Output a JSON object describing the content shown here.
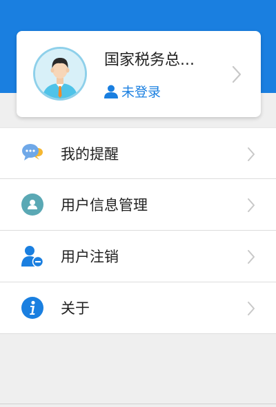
{
  "profile": {
    "name": "国家税务总...",
    "status": "未登录",
    "avatar_icon": "male-user-avatar",
    "status_icon": "user-icon"
  },
  "menu": {
    "items": [
      {
        "label": "我的提醒",
        "icon": "chat-bubble-icon"
      },
      {
        "label": "用户信息管理",
        "icon": "user-info-icon"
      },
      {
        "label": "用户注销",
        "icon": "user-remove-icon"
      },
      {
        "label": "关于",
        "icon": "info-icon"
      }
    ]
  },
  "colors": {
    "accent": "#1a7fe0",
    "background": "#efefef"
  }
}
